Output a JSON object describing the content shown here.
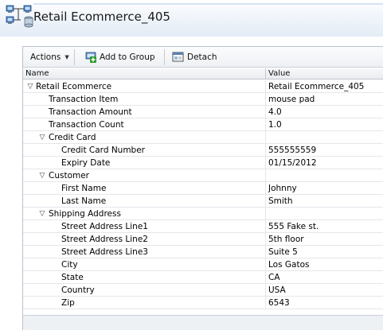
{
  "page": {
    "title": "Retail Ecommerce_405"
  },
  "toolbar": {
    "actions_label": "Actions",
    "add_to_group_label": "Add to Group",
    "detach_label": "Detach"
  },
  "table": {
    "columns": [
      "Name",
      "Value"
    ],
    "rows": [
      {
        "name": "Retail Ecommerce",
        "value": "Retail Ecommerce_405",
        "level": 0,
        "expandable": true
      },
      {
        "name": "Transaction Item",
        "value": "mouse pad",
        "level": 1,
        "expandable": false
      },
      {
        "name": "Transaction Amount",
        "value": "4.0",
        "level": 1,
        "expandable": false
      },
      {
        "name": "Transaction Count",
        "value": "1.0",
        "level": 1,
        "expandable": false
      },
      {
        "name": "Credit Card",
        "value": "",
        "level": 1,
        "expandable": true
      },
      {
        "name": "Credit Card Number",
        "value": "555555559",
        "level": 2,
        "expandable": false
      },
      {
        "name": "Expiry Date",
        "value": "01/15/2012",
        "level": 2,
        "expandable": false
      },
      {
        "name": "Customer",
        "value": "",
        "level": 1,
        "expandable": true
      },
      {
        "name": "First Name",
        "value": "Johnny",
        "level": 2,
        "expandable": false
      },
      {
        "name": "Last Name",
        "value": "Smith",
        "level": 2,
        "expandable": false
      },
      {
        "name": "Shipping Address",
        "value": "",
        "level": 1,
        "expandable": true
      },
      {
        "name": "Street Address Line1",
        "value": "555 Fake st.",
        "level": 2,
        "expandable": false
      },
      {
        "name": "Street Address Line2",
        "value": "5th floor",
        "level": 2,
        "expandable": false
      },
      {
        "name": "Street Address Line3",
        "value": "Suite 5",
        "level": 2,
        "expandable": false
      },
      {
        "name": "City",
        "value": "Los Gatos",
        "level": 2,
        "expandable": false
      },
      {
        "name": "State",
        "value": "CA",
        "level": 2,
        "expandable": false
      },
      {
        "name": "Country",
        "value": "USA",
        "level": 2,
        "expandable": false
      },
      {
        "name": "Zip",
        "value": "6543",
        "level": 2,
        "expandable": false
      }
    ]
  },
  "icons": {
    "title": "network-servers-icon",
    "add_to_group": "add-group-icon",
    "detach": "detach-icon",
    "expand": "triangle-down-icon"
  }
}
